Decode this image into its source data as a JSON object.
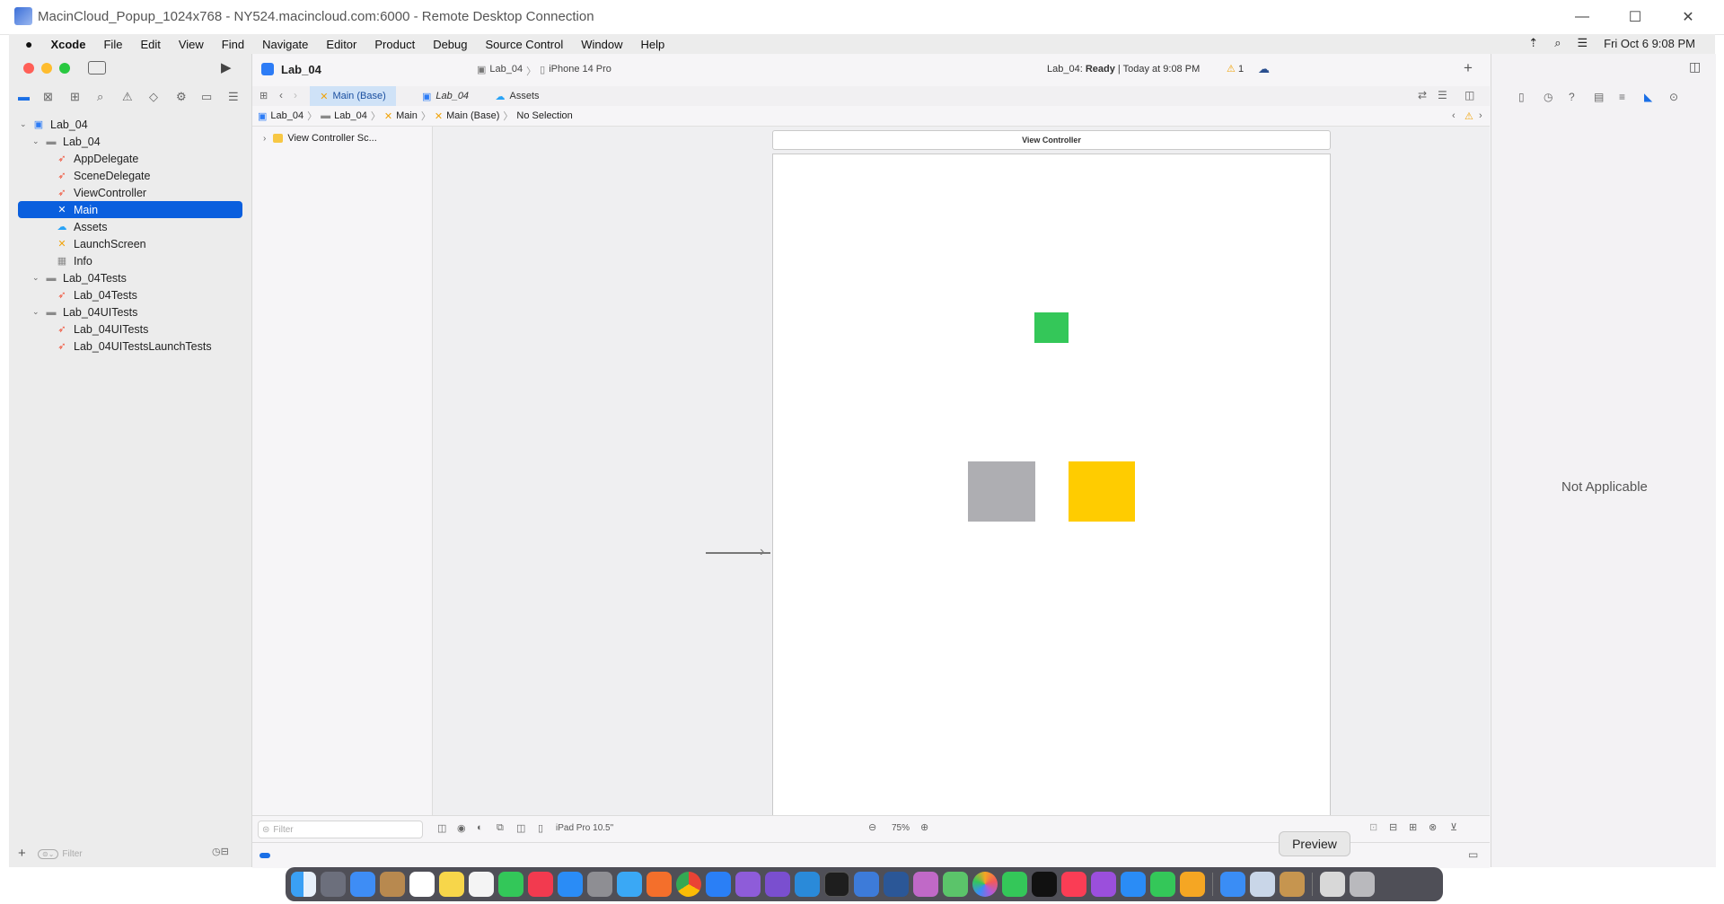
{
  "rdp": {
    "title": "MacinCloud_Popup_1024x768 - NY524.macincloud.com:6000 - Remote Desktop Connection",
    "minimize": "—",
    "maximize": "☐",
    "close": "✕"
  },
  "menubar": {
    "apple": "",
    "items": [
      "Xcode",
      "File",
      "Edit",
      "View",
      "Find",
      "Navigate",
      "Editor",
      "Product",
      "Debug",
      "Source Control",
      "Window",
      "Help"
    ],
    "datetime": "Fri Oct 6  9:08 PM"
  },
  "toolbar": {
    "project": "Lab_04",
    "scheme": "Lab_04",
    "scheme_sep": "〉",
    "device": "iPhone 14 Pro",
    "status_prefix": "Lab_04: ",
    "status_state": "Ready",
    "status_suffix": " | Today at 9:08 PM",
    "warning_count": "1",
    "run_glyph": "▶",
    "add_glyph": "+"
  },
  "tabs": [
    {
      "label": "Main (Base)"
    },
    {
      "label": "Lab_04"
    },
    {
      "label": "Assets"
    }
  ],
  "jumpbar": [
    "Lab_04",
    "Lab_04",
    "Main",
    "Main (Base)",
    "No Selection"
  ],
  "navigator": {
    "rows": [
      {
        "label": "Lab_04"
      },
      {
        "label": "Lab_04"
      },
      {
        "label": "AppDelegate"
      },
      {
        "label": "SceneDelegate"
      },
      {
        "label": "ViewController"
      },
      {
        "label": "Main"
      },
      {
        "label": "Assets"
      },
      {
        "label": "LaunchScreen"
      },
      {
        "label": "Info"
      },
      {
        "label": "Lab_04Tests"
      },
      {
        "label": "Lab_04Tests"
      },
      {
        "label": "Lab_04UITests"
      },
      {
        "label": "Lab_04UITests"
      },
      {
        "label": "Lab_04UITestsLaunchTests"
      }
    ],
    "filter_placeholder": "Filter"
  },
  "outline": {
    "scene": "View Controller Sc..."
  },
  "canvas": {
    "scene_title": "View Controller",
    "colors": {
      "green": "#34c759",
      "gray": "#aeaeb2",
      "yellow": "#ffcc00"
    }
  },
  "bottombar": {
    "filter_placeholder": "Filter",
    "device": "iPad Pro 10.5\"",
    "zoom": "75%"
  },
  "inspector": {
    "empty": "Not Applicable"
  },
  "tooltip": {
    "label": "Preview"
  }
}
